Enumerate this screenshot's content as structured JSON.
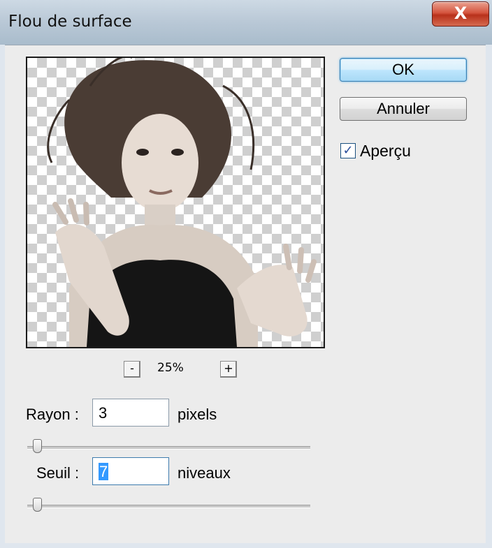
{
  "window": {
    "title": "Flou de surface",
    "close_label": "X"
  },
  "buttons": {
    "ok": "OK",
    "cancel": "Annuler"
  },
  "preview_option": {
    "label": "Aperçu",
    "checked": true
  },
  "zoom": {
    "minus": "-",
    "plus": "+",
    "level": "25%"
  },
  "radius": {
    "label": "Rayon :",
    "value": "3",
    "unit": "pixels",
    "slider_fraction": 0.02
  },
  "threshold": {
    "label": "Seuil :",
    "value": "7",
    "unit": "niveaux",
    "slider_fraction": 0.02
  }
}
